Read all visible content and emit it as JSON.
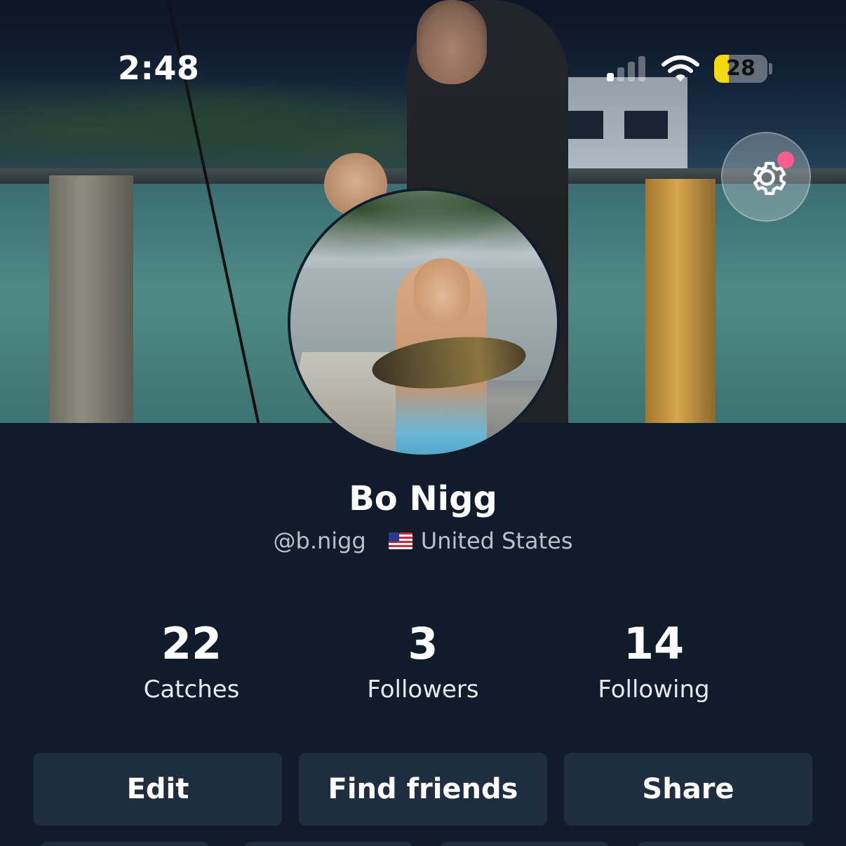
{
  "status_bar": {
    "time": "2:48",
    "battery_level": "28",
    "battery_fraction": 0.28,
    "signal_bars": 1,
    "wifi_icon": "wifi-icon",
    "signal_icon": "cellular-signal-icon"
  },
  "header": {
    "settings_icon": "gear-icon",
    "settings_has_notification": true
  },
  "profile": {
    "name": "Bo Nigg",
    "handle": "@b.nigg",
    "country": "United States",
    "flag_icon": "us-flag-icon"
  },
  "stats": [
    {
      "value": "22",
      "label": "Catches"
    },
    {
      "value": "3",
      "label": "Followers"
    },
    {
      "value": "14",
      "label": "Following"
    }
  ],
  "actions": {
    "edit_label": "Edit",
    "find_friends_label": "Find friends",
    "share_label": "Share"
  },
  "colors": {
    "background": "#101c2b",
    "button": "#1f2d40",
    "battery_fill": "#f5d90a",
    "notification_dot": "#ff5c8a"
  }
}
